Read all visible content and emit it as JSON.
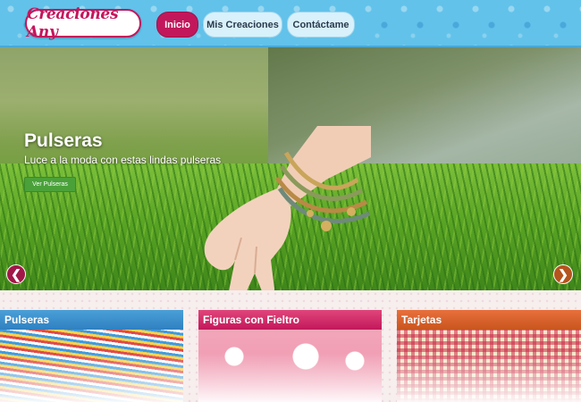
{
  "header": {
    "logo_text": "Creaciones Any",
    "nav": [
      {
        "label": "Inicio",
        "active": true
      },
      {
        "label": "Mis Creaciones",
        "active": false
      },
      {
        "label": "Contáctame",
        "active": false
      }
    ]
  },
  "hero": {
    "title": "Pulseras",
    "subtitle": "Luce a la moda con estas lindas pulseras",
    "button_label": "Ver Pulseras",
    "prev_arrow": "❮",
    "next_arrow": "❯"
  },
  "categories": [
    {
      "title": "Pulseras",
      "color": "#2f80c0"
    },
    {
      "title": "Figuras con Fieltro",
      "color": "#c2185b"
    },
    {
      "title": "Tarjetas",
      "color": "#c9551e"
    }
  ],
  "colors": {
    "brand": "#c4165d",
    "header_bg": "#62c2ea",
    "hero_button": "#4aa13a"
  }
}
